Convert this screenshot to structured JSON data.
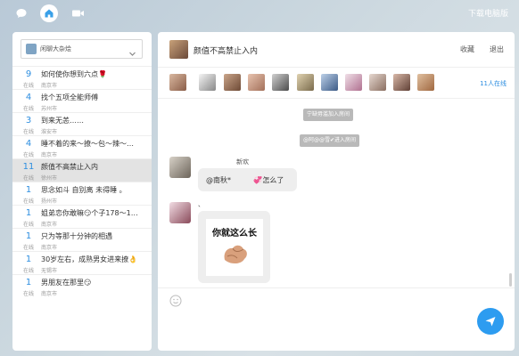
{
  "top": {
    "download_label": "下载电脑版"
  },
  "sidebar": {
    "selector_label": "闲聊大杂烩",
    "rooms": [
      {
        "count": "9",
        "online": "在线",
        "name": "如何使你想到六点🌹",
        "city": "南京市"
      },
      {
        "count": "4",
        "online": "在线",
        "name": "找个五项全能师傅",
        "city": "苏州市"
      },
      {
        "count": "3",
        "online": "在线",
        "name": "到来无恙……",
        "city": "淮安市"
      },
      {
        "count": "4",
        "online": "在线",
        "name": "睡不着的来～撩～包～辣～…",
        "city": "南京市"
      },
      {
        "count": "11",
        "online": "在线",
        "name": "颜值不高禁止入内",
        "city": "徐州市"
      },
      {
        "count": "1",
        "online": "在线",
        "name": "思念如斗 自别离 未得睡 。",
        "city": "扬州市"
      },
      {
        "count": "1",
        "online": "在线",
        "name": "姐弟恋你敢嘛😏个子178～1…",
        "city": "南京市"
      },
      {
        "count": "1",
        "online": "在线",
        "name": "只为等那十分钟的相遇",
        "city": "南京市"
      },
      {
        "count": "1",
        "online": "在线",
        "name": "30岁左右，成熟男女进来撩👌",
        "city": "无锡市"
      },
      {
        "count": "1",
        "online": "在线",
        "name": "男朋友在那里😏",
        "city": "南京市"
      }
    ]
  },
  "chat": {
    "title": "颜值不高禁止入内",
    "favorite_label": "收藏",
    "exit_label": "退出",
    "online_count": "11人在线",
    "system_messages": [
      "宁缺毋滥加入房间",
      "@阿@@雪✔进入房间"
    ],
    "message1": {
      "sender": "新欢",
      "text": "@南秋*          💞怎么了"
    },
    "message2": {
      "sender": "、",
      "sticker_text": "你就这么长"
    }
  },
  "colors": {
    "accent": "#2d9cf0",
    "link": "#2d8ee0",
    "active_row": "#e3e3e3"
  },
  "icons": [
    "chat-icon",
    "home-icon",
    "video-icon",
    "chevron-down-icon",
    "emoji-icon",
    "send-icon"
  ]
}
